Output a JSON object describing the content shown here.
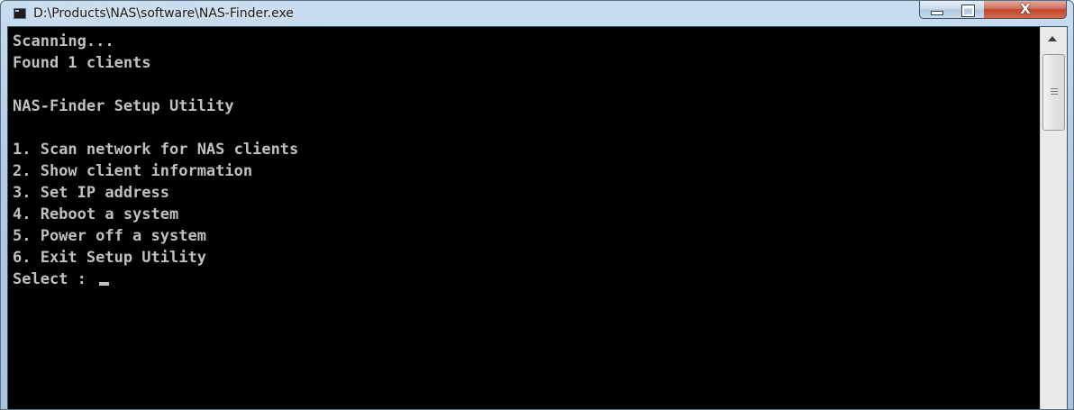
{
  "window": {
    "title": "D:\\Products\\NAS\\software\\NAS-Finder.exe",
    "icon": "console-app-icon",
    "controls": {
      "minimize_icon": "minimize-icon",
      "maximize_icon": "maximize-icon",
      "close_label": "X"
    }
  },
  "console": {
    "lines": [
      "Scanning...",
      "Found 1 clients",
      "",
      "NAS-Finder Setup Utility",
      "",
      "1. Scan network for NAS clients",
      "2. Show client information",
      "3. Set IP address",
      "4. Reboot a system",
      "5. Power off a system",
      "6. Exit Setup Utility"
    ],
    "prompt": "Select : ",
    "text_color": "#c0c0c0",
    "background_color": "#000000"
  }
}
